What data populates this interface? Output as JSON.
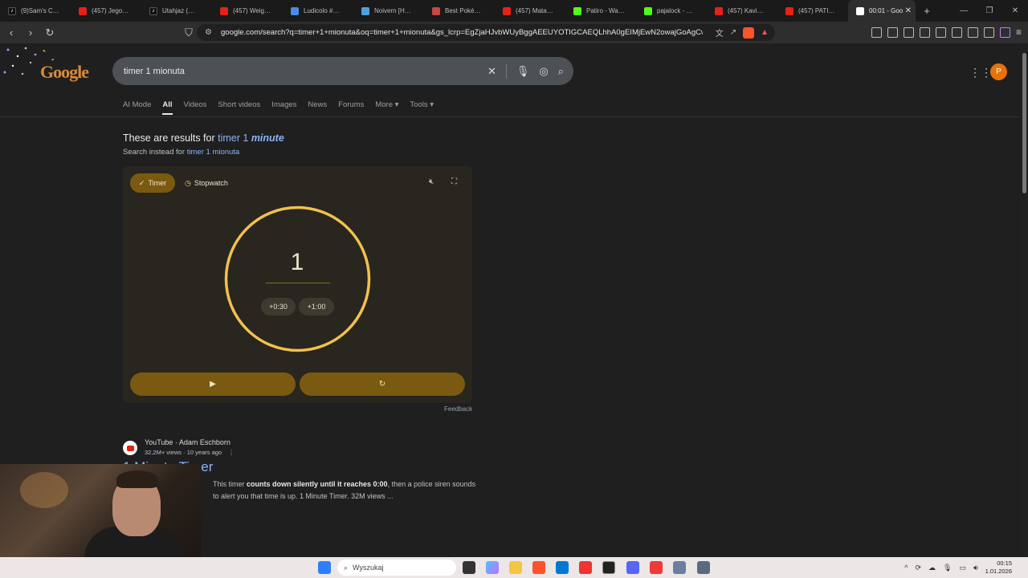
{
  "tabs": [
    {
      "title": "(9)Sam's Club F",
      "icon": "tiktok-icon"
    },
    {
      "title": "(457) Jego karty",
      "icon": "youtube-icon"
    },
    {
      "title": "Utahjaz (@utah",
      "icon": "tiktok-icon"
    },
    {
      "title": "(457) Weighing",
      "icon": "youtube-icon"
    },
    {
      "title": "Ludicolo #37 P",
      "icon": "doc-icon"
    },
    {
      "title": "Noivern [Holo]",
      "icon": "eye-icon"
    },
    {
      "title": "Best Pokémon",
      "icon": "pokeball-icon"
    },
    {
      "title": "(457) Mata - Po",
      "icon": "youtube-icon"
    },
    {
      "title": "Patiro - Watch",
      "icon": "kick-icon"
    },
    {
      "title": "pajalock - Watc",
      "icon": "kick-icon"
    },
    {
      "title": "(457) Kavinsky",
      "icon": "youtube-icon"
    },
    {
      "title": "(457) PATIRO Z",
      "icon": "youtube-icon"
    },
    {
      "title": "00:01 - Goo",
      "icon": "google-icon",
      "active": true
    }
  ],
  "address": {
    "url": "google.com/search?q=timer+1+mionuta&oq=timer+1+mionuta&gs_lcrp=EgZjaHJvbWUyBggAEEUYOTIGCAEQLhhA0gEIMjEwN2owajGoAgCw..."
  },
  "google": {
    "logo": "Google",
    "query": "timer 1 mionuta",
    "avatar_letter": "P",
    "nav_tabs": [
      "AI Mode",
      "All",
      "Videos",
      "Short videos",
      "Images",
      "News",
      "Forums",
      "More ▾",
      "Tools ▾"
    ],
    "active_tab": "All",
    "spell_prefix": "These are results for",
    "spell_corrected_a": "timer 1",
    "spell_corrected_b": "minute",
    "spell_instead_prefix": "Search instead for",
    "spell_original": "timer 1 mionuta"
  },
  "timer": {
    "mode_timer": "Timer",
    "mode_stopwatch": "Stopwatch",
    "display": "1",
    "add_30": "+0:30",
    "add_60": "+1:00",
    "play_symbol": "▶",
    "reset_symbol": "↻",
    "feedback": "Feedback",
    "accent": "#f2c14e"
  },
  "result": {
    "source": "YouTube · Adam Eschborn",
    "meta": "32,2M+ views · 10 years ago",
    "title": "1 Minute Timer",
    "snippet_a": "This timer ",
    "snippet_bold": "counts down silently until it reaches 0:00",
    "snippet_b": ", then a police siren sounds to alert you that time is up. 1 Minute Timer. 32M views ..."
  },
  "taskbar": {
    "search_placeholder": "Wyszukaj",
    "time": "00:15",
    "date": "1.01.2026"
  }
}
